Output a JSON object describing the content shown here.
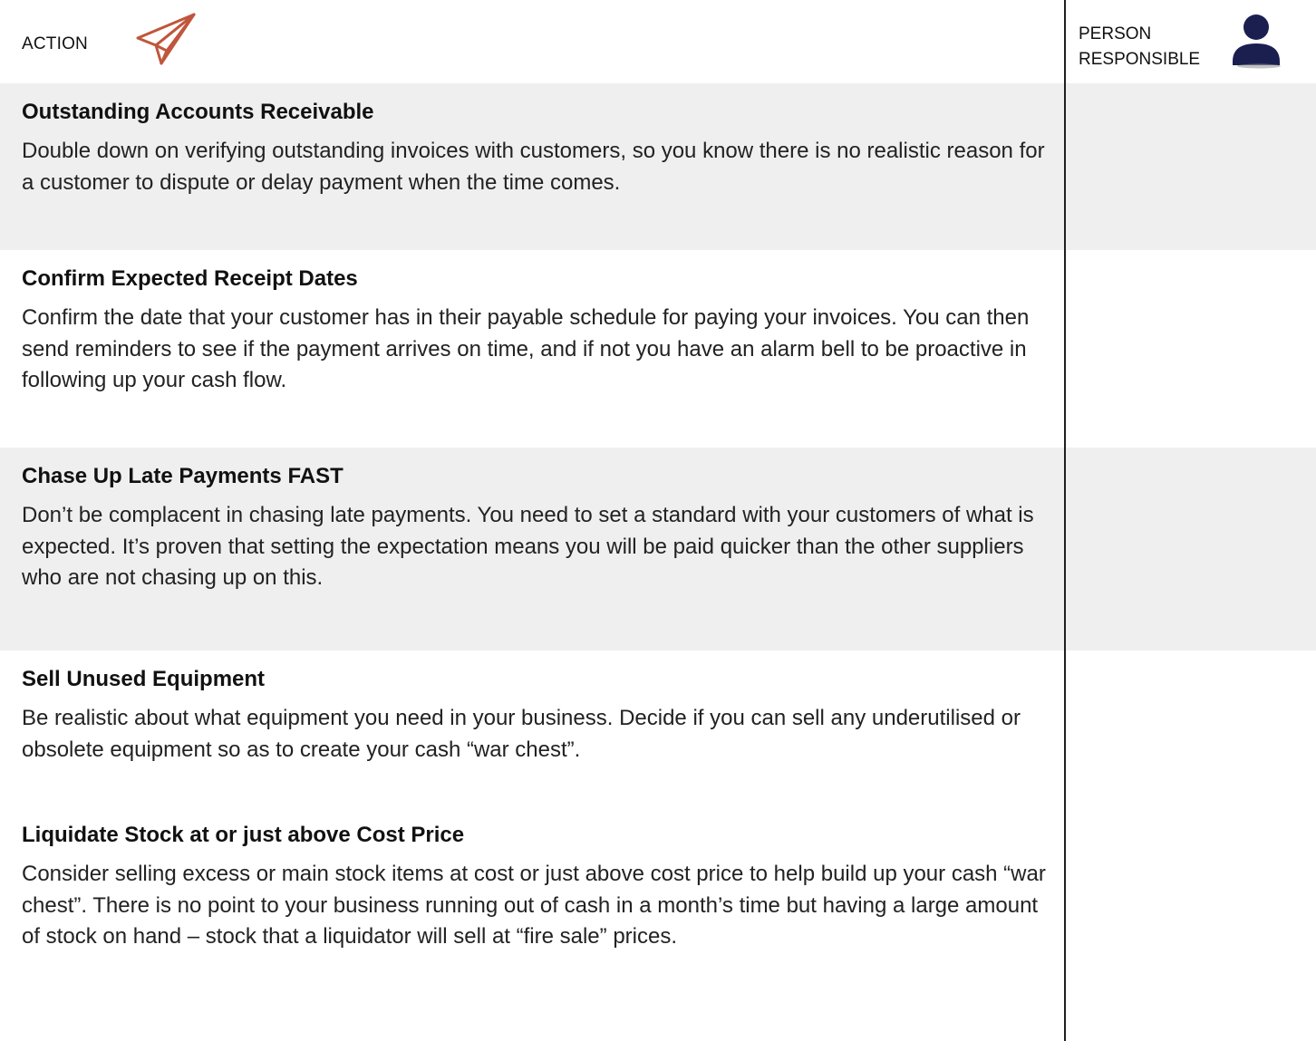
{
  "header": {
    "action_label": "ACTION",
    "person_label_line1": "PERSON",
    "person_label_line2": "RESPONSIBLE",
    "plane_icon": "paper-plane-icon",
    "person_icon": "person-icon",
    "plane_color": "#c0563b",
    "person_color": "#1b1f50"
  },
  "actions": [
    {
      "title": "Outstanding Accounts Receivable",
      "body": "Double down on verifying outstanding invoices with customers, so you know there is no realistic reason for a customer to dispute or delay payment when the time comes.",
      "person_responsible": ""
    },
    {
      "title": "Confirm Expected Receipt Dates",
      "body": "Confirm the date that your customer has in their payable schedule for paying your invoices. You can then send reminders to see if the payment arrives on time, and if not you have an alarm bell to be proactive in following up your cash flow.",
      "person_responsible": ""
    },
    {
      "title": "Chase Up Late Payments FAST",
      "body": "Don’t be complacent in chasing late payments. You need to set a standard with your customers of what is expected. It’s proven that setting the expectation means you will be paid quicker than the other suppliers who are not chasing up on this.",
      "person_responsible": ""
    },
    {
      "title": "Sell Unused Equipment",
      "body": "Be realistic about what equipment you need in your business. Decide if you can sell any underutilised or obsolete equipment so as to create your cash “war chest”.",
      "person_responsible": ""
    },
    {
      "title": "Liquidate Stock at or just above Cost Price",
      "body": "Consider selling excess or main stock items at cost or just above cost price to help build up your cash “war chest”. There is no point to your business running out of cash in a month’s time but having a large amount of stock on hand – stock that a liquidator will sell at “fire sale” prices.",
      "person_responsible": ""
    }
  ]
}
